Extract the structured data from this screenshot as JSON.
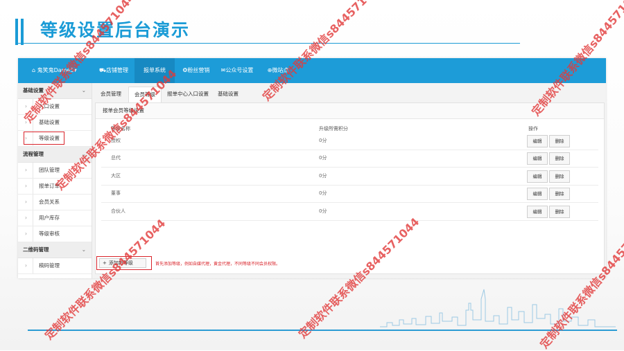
{
  "slide": {
    "title": "等级设置后台演示"
  },
  "topnav": {
    "brand": "鬼笑鬼DameS▾",
    "items": [
      {
        "icon": "store-icon",
        "label": "店铺管理"
      },
      {
        "icon": "list-icon",
        "label": "报单系统"
      },
      {
        "icon": "fans-icon",
        "label": "粉丝营销"
      },
      {
        "icon": "chat-icon",
        "label": "公众号设置"
      },
      {
        "icon": "globe-icon",
        "label": "微站点"
      }
    ]
  },
  "sidebar": {
    "groups": [
      {
        "title": "基础设置",
        "items": [
          "入口设置",
          "基础设置",
          "等级设置"
        ]
      },
      {
        "title": "流程管理",
        "items": [
          "团队管理",
          "报单订单",
          "会员关系",
          "用户库存",
          "等级审核"
        ]
      },
      {
        "title": "二维码管理",
        "items": [
          "稿码管理"
        ]
      }
    ]
  },
  "tabs": [
    "会员管理",
    "会员等级",
    "报单中心入口设置",
    "基础设置"
  ],
  "panel": {
    "title": "报单会员等级设置",
    "columns": [
      "等级名称",
      "升级所需积分",
      "操作"
    ],
    "rows": [
      {
        "name": "授权",
        "points": "0分"
      },
      {
        "name": "总代",
        "points": "0分"
      },
      {
        "name": "大区",
        "points": "0分"
      },
      {
        "name": "董事",
        "points": "0分"
      },
      {
        "name": "合伙人",
        "points": "0分"
      }
    ],
    "edit_label": "编辑",
    "delete_label": "删除",
    "add_label": "添加新等级",
    "note": "首先添加等级，例如自媒代理，黄金代理，不同等级不同会员权限。"
  },
  "watermark": "定制软件联系微信s844571044",
  "colors": {
    "brand": "#1d9cd8",
    "highlight": "#d9232a"
  }
}
